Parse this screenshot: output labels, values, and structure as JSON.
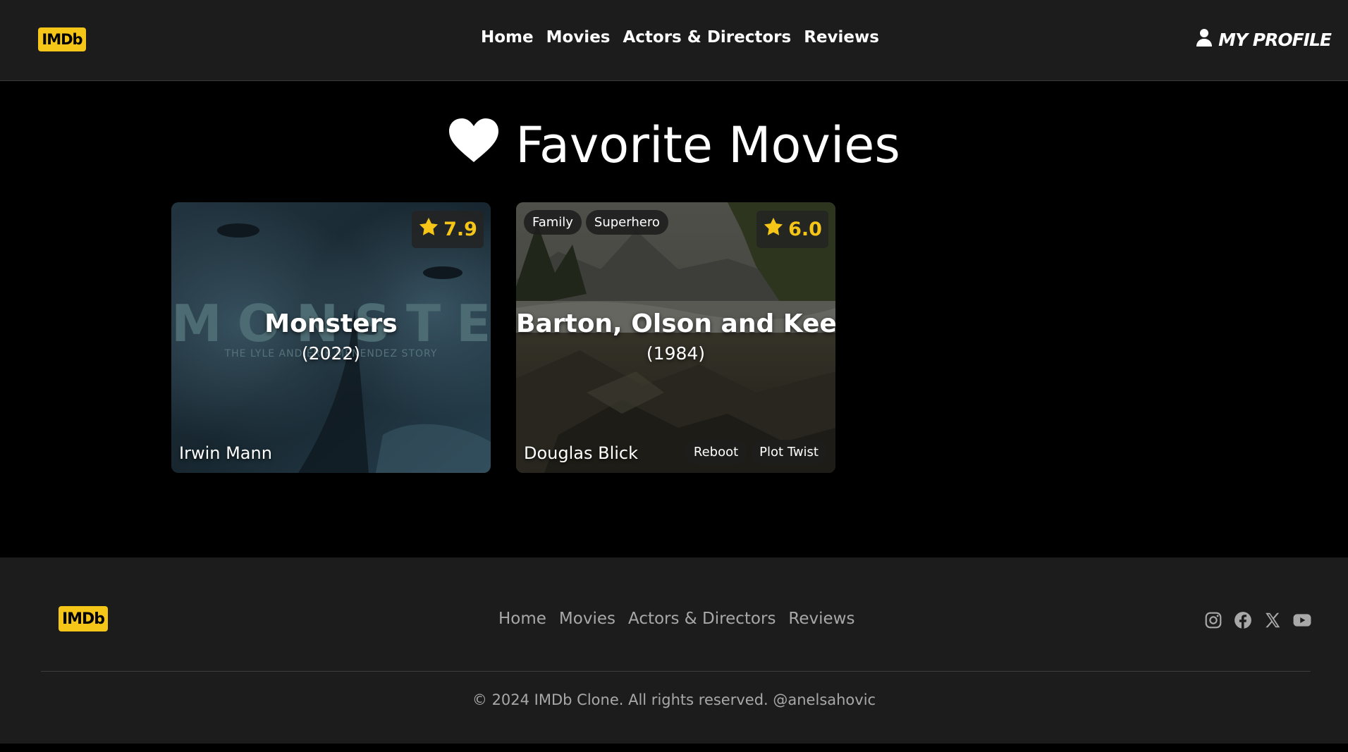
{
  "header": {
    "logo": "IMDb",
    "nav": [
      "Home",
      "Movies",
      "Actors & Directors",
      "Reviews"
    ],
    "profile_label": "MY PROFILE",
    "profile_icon": "user-icon"
  },
  "page": {
    "title": "Favorite Movies",
    "title_icon": "heart-icon"
  },
  "movies": [
    {
      "title": "Monsters",
      "year": "(2022)",
      "rating": "7.9",
      "director": "Irwin Mann",
      "top_tags": [],
      "bottom_tags": [],
      "poster_text": "MONSTERS",
      "poster_subtext": "THE LYLE AND ERIK MENENDEZ STORY"
    },
    {
      "title": "Barton, Olson and Keebler",
      "year": "(1984)",
      "rating": "6.0",
      "director": "Douglas Blick",
      "top_tags": [
        "Family",
        "Superhero"
      ],
      "bottom_tags": [
        "Reboot",
        "Plot Twist"
      ]
    }
  ],
  "footer": {
    "logo": "IMDb",
    "nav": [
      "Home",
      "Movies",
      "Actors & Directors",
      "Reviews"
    ],
    "social": [
      "instagram-icon",
      "facebook-icon",
      "x-icon",
      "youtube-icon"
    ],
    "copyright": "© 2024 IMDb Clone. All rights reserved. @anelsahovic"
  },
  "colors": {
    "accent": "#f5c518",
    "header_bg": "#1c1c1c",
    "page_bg": "#000000",
    "muted_text": "#a8a8a8"
  }
}
